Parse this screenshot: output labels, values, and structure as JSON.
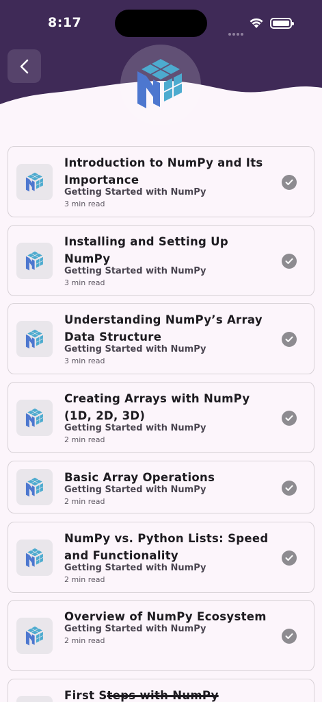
{
  "status_bar": {
    "time": "8:17"
  },
  "header": {
    "back_icon": "chevron-left-icon",
    "logo_icon": "numpy-logo-icon",
    "bg_color": "#3f2a57"
  },
  "lessons": [
    {
      "title": "Introduction to NumPy and Its Importance",
      "subtitle": "Getting Started with NumPy",
      "read_time": "3 min read",
      "completed": true
    },
    {
      "title": "Installing and Setting Up NumPy",
      "subtitle": "Getting Started with NumPy",
      "read_time": "3 min read",
      "completed": true
    },
    {
      "title": "Understanding NumPy’s Array Data Structure",
      "subtitle": "Getting Started with NumPy",
      "read_time": "3 min read",
      "completed": true
    },
    {
      "title": "Creating Arrays with NumPy (1D, 2D, 3D)",
      "subtitle": "Getting Started with NumPy",
      "read_time": "2 min read",
      "completed": true
    },
    {
      "title": "Basic Array Operations",
      "subtitle": "Getting Started with NumPy",
      "read_time": "2 min read",
      "completed": true
    },
    {
      "title": "NumPy vs. Python Lists: Speed and Functionality",
      "subtitle": "Getting Started with NumPy",
      "read_time": "2 min read",
      "completed": true
    },
    {
      "title": "Overview of NumPy Ecosystem",
      "subtitle": "Getting Started with NumPy",
      "read_time": "2 min read",
      "completed": true
    },
    {
      "title": "First Steps with NumPy",
      "subtitle": "",
      "read_time": "",
      "completed": false
    }
  ]
}
